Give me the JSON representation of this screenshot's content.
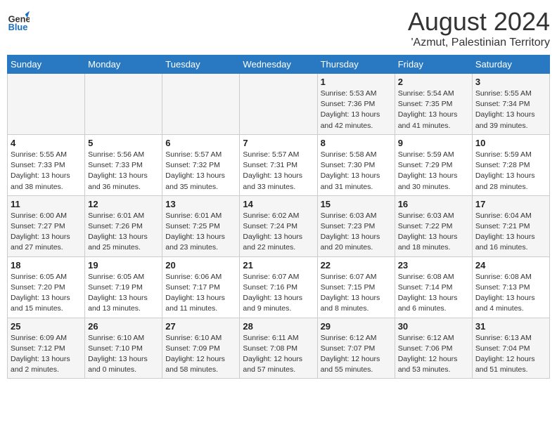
{
  "header": {
    "logo_line1": "General",
    "logo_line2": "Blue",
    "title": "August 2024",
    "subtitle": "'Azmut, Palestinian Territory"
  },
  "weekdays": [
    "Sunday",
    "Monday",
    "Tuesday",
    "Wednesday",
    "Thursday",
    "Friday",
    "Saturday"
  ],
  "weeks": [
    [
      {
        "day": "",
        "detail": ""
      },
      {
        "day": "",
        "detail": ""
      },
      {
        "day": "",
        "detail": ""
      },
      {
        "day": "",
        "detail": ""
      },
      {
        "day": "1",
        "detail": "Sunrise: 5:53 AM\nSunset: 7:36 PM\nDaylight: 13 hours\nand 42 minutes."
      },
      {
        "day": "2",
        "detail": "Sunrise: 5:54 AM\nSunset: 7:35 PM\nDaylight: 13 hours\nand 41 minutes."
      },
      {
        "day": "3",
        "detail": "Sunrise: 5:55 AM\nSunset: 7:34 PM\nDaylight: 13 hours\nand 39 minutes."
      }
    ],
    [
      {
        "day": "4",
        "detail": "Sunrise: 5:55 AM\nSunset: 7:33 PM\nDaylight: 13 hours\nand 38 minutes."
      },
      {
        "day": "5",
        "detail": "Sunrise: 5:56 AM\nSunset: 7:33 PM\nDaylight: 13 hours\nand 36 minutes."
      },
      {
        "day": "6",
        "detail": "Sunrise: 5:57 AM\nSunset: 7:32 PM\nDaylight: 13 hours\nand 35 minutes."
      },
      {
        "day": "7",
        "detail": "Sunrise: 5:57 AM\nSunset: 7:31 PM\nDaylight: 13 hours\nand 33 minutes."
      },
      {
        "day": "8",
        "detail": "Sunrise: 5:58 AM\nSunset: 7:30 PM\nDaylight: 13 hours\nand 31 minutes."
      },
      {
        "day": "9",
        "detail": "Sunrise: 5:59 AM\nSunset: 7:29 PM\nDaylight: 13 hours\nand 30 minutes."
      },
      {
        "day": "10",
        "detail": "Sunrise: 5:59 AM\nSunset: 7:28 PM\nDaylight: 13 hours\nand 28 minutes."
      }
    ],
    [
      {
        "day": "11",
        "detail": "Sunrise: 6:00 AM\nSunset: 7:27 PM\nDaylight: 13 hours\nand 27 minutes."
      },
      {
        "day": "12",
        "detail": "Sunrise: 6:01 AM\nSunset: 7:26 PM\nDaylight: 13 hours\nand 25 minutes."
      },
      {
        "day": "13",
        "detail": "Sunrise: 6:01 AM\nSunset: 7:25 PM\nDaylight: 13 hours\nand 23 minutes."
      },
      {
        "day": "14",
        "detail": "Sunrise: 6:02 AM\nSunset: 7:24 PM\nDaylight: 13 hours\nand 22 minutes."
      },
      {
        "day": "15",
        "detail": "Sunrise: 6:03 AM\nSunset: 7:23 PM\nDaylight: 13 hours\nand 20 minutes."
      },
      {
        "day": "16",
        "detail": "Sunrise: 6:03 AM\nSunset: 7:22 PM\nDaylight: 13 hours\nand 18 minutes."
      },
      {
        "day": "17",
        "detail": "Sunrise: 6:04 AM\nSunset: 7:21 PM\nDaylight: 13 hours\nand 16 minutes."
      }
    ],
    [
      {
        "day": "18",
        "detail": "Sunrise: 6:05 AM\nSunset: 7:20 PM\nDaylight: 13 hours\nand 15 minutes."
      },
      {
        "day": "19",
        "detail": "Sunrise: 6:05 AM\nSunset: 7:19 PM\nDaylight: 13 hours\nand 13 minutes."
      },
      {
        "day": "20",
        "detail": "Sunrise: 6:06 AM\nSunset: 7:17 PM\nDaylight: 13 hours\nand 11 minutes."
      },
      {
        "day": "21",
        "detail": "Sunrise: 6:07 AM\nSunset: 7:16 PM\nDaylight: 13 hours\nand 9 minutes."
      },
      {
        "day": "22",
        "detail": "Sunrise: 6:07 AM\nSunset: 7:15 PM\nDaylight: 13 hours\nand 8 minutes."
      },
      {
        "day": "23",
        "detail": "Sunrise: 6:08 AM\nSunset: 7:14 PM\nDaylight: 13 hours\nand 6 minutes."
      },
      {
        "day": "24",
        "detail": "Sunrise: 6:08 AM\nSunset: 7:13 PM\nDaylight: 13 hours\nand 4 minutes."
      }
    ],
    [
      {
        "day": "25",
        "detail": "Sunrise: 6:09 AM\nSunset: 7:12 PM\nDaylight: 13 hours\nand 2 minutes."
      },
      {
        "day": "26",
        "detail": "Sunrise: 6:10 AM\nSunset: 7:10 PM\nDaylight: 13 hours\nand 0 minutes."
      },
      {
        "day": "27",
        "detail": "Sunrise: 6:10 AM\nSunset: 7:09 PM\nDaylight: 12 hours\nand 58 minutes."
      },
      {
        "day": "28",
        "detail": "Sunrise: 6:11 AM\nSunset: 7:08 PM\nDaylight: 12 hours\nand 57 minutes."
      },
      {
        "day": "29",
        "detail": "Sunrise: 6:12 AM\nSunset: 7:07 PM\nDaylight: 12 hours\nand 55 minutes."
      },
      {
        "day": "30",
        "detail": "Sunrise: 6:12 AM\nSunset: 7:06 PM\nDaylight: 12 hours\nand 53 minutes."
      },
      {
        "day": "31",
        "detail": "Sunrise: 6:13 AM\nSunset: 7:04 PM\nDaylight: 12 hours\nand 51 minutes."
      }
    ]
  ]
}
